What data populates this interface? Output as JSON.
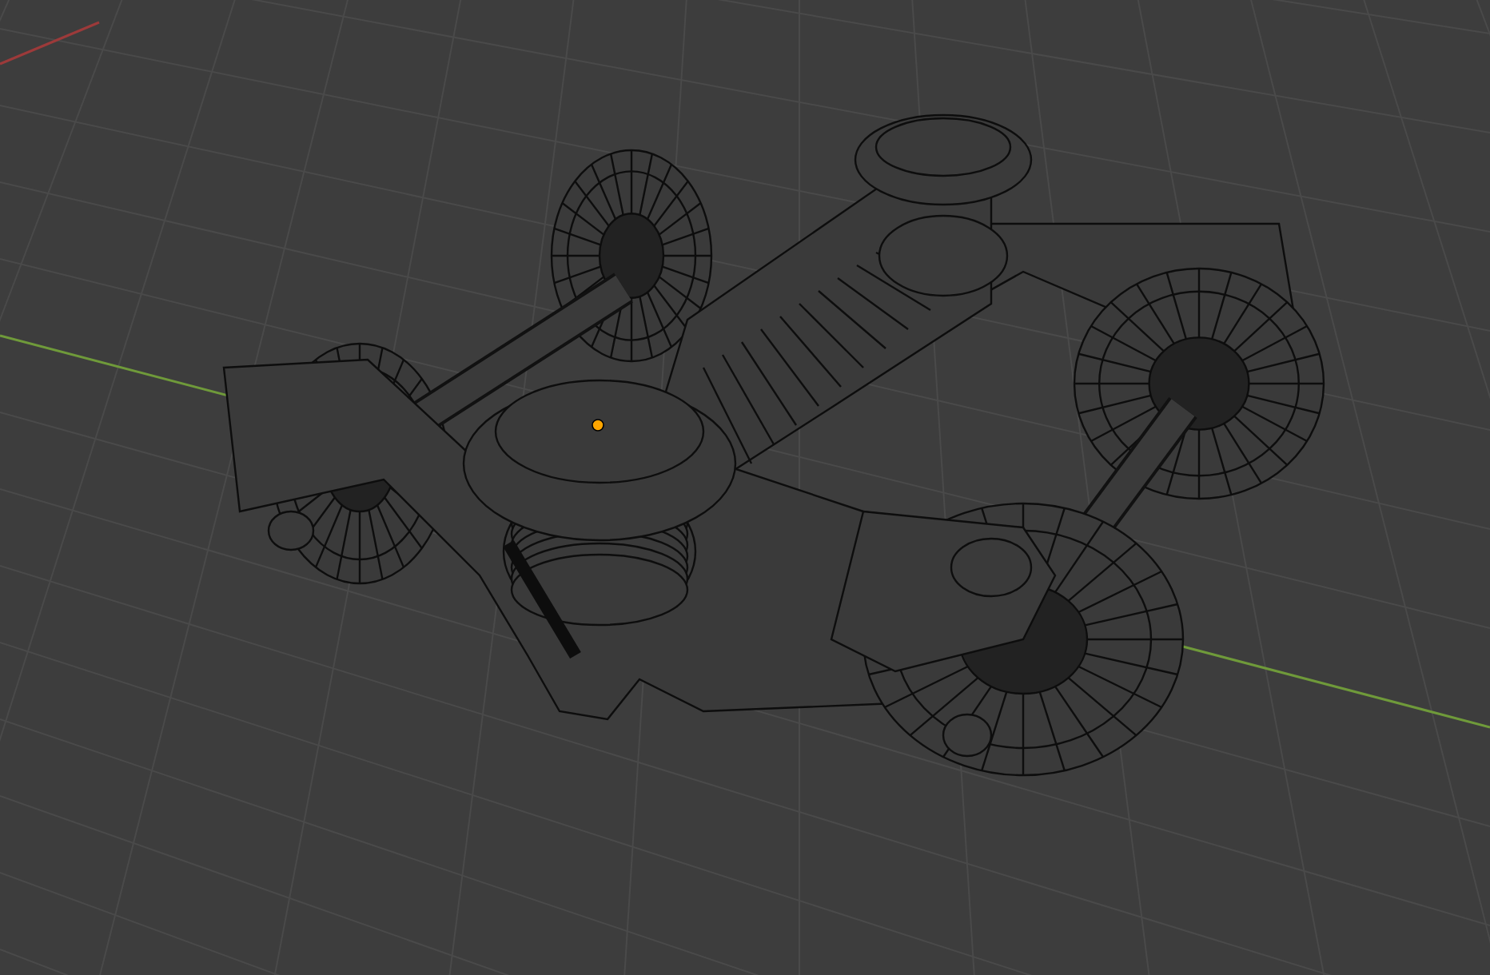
{
  "viewport": {
    "axes": [
      {
        "color": "#9c3a3a"
      },
      {
        "color": "#6f9a3a"
      }
    ]
  }
}
